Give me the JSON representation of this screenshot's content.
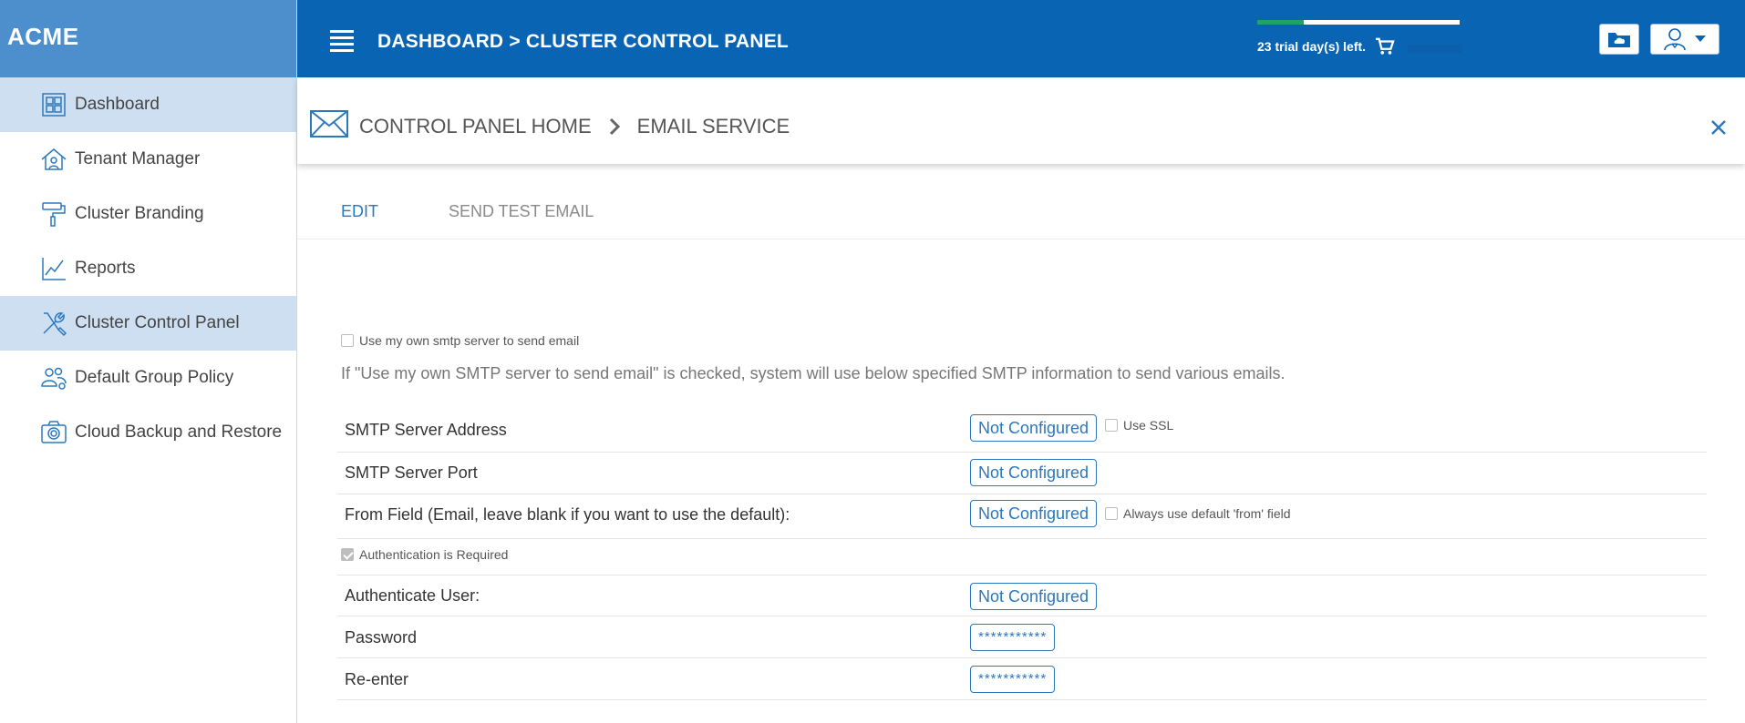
{
  "brand": "ACME",
  "sidebar": {
    "items": [
      {
        "label": "Dashboard",
        "icon": "dashboard-grid-icon",
        "active": true
      },
      {
        "label": "Tenant Manager",
        "icon": "tenant-house-icon",
        "active": false
      },
      {
        "label": "Cluster Branding",
        "icon": "paint-roller-icon",
        "active": false
      },
      {
        "label": "Reports",
        "icon": "line-chart-icon",
        "active": false
      },
      {
        "label": "Cluster Control Panel",
        "icon": "wrench-screwdriver-icon",
        "active": true
      },
      {
        "label": "Default Group Policy",
        "icon": "users-gear-icon",
        "active": false
      },
      {
        "label": "Cloud Backup and Restore",
        "icon": "camera-icon",
        "active": false
      }
    ]
  },
  "topbar": {
    "title": "DASHBOARD > CLUSTER CONTROL PANEL",
    "trial_text": "23 trial day(s) left.",
    "trial_progress": 0.23
  },
  "breadcrumb": {
    "home": "CONTROL PANEL HOME",
    "current": "EMAIL SERVICE"
  },
  "tabs": {
    "edit": "EDIT",
    "send_test": "SEND TEST EMAIL"
  },
  "form": {
    "use_own_smtp_label": "Use my own smtp server to send email",
    "use_own_smtp_checked": false,
    "help_text": "If \"Use my own SMTP server to send email\" is checked, system will use below specified SMTP information to send various emails.",
    "server_address_label": "SMTP Server Address",
    "server_address_value": "Not Configured",
    "use_ssl_label": "Use SSL",
    "server_port_label": "SMTP Server Port",
    "server_port_value": "Not Configured",
    "from_field_label": "From Field (Email, leave blank if you want to use the default):",
    "from_field_value": "Not Configured",
    "always_default_label": "Always use default 'from' field",
    "auth_required_label": "Authentication is Required",
    "auth_required_checked": true,
    "auth_user_label": "Authenticate User:",
    "auth_user_value": "Not Configured",
    "password_label": "Password",
    "password_value": "***********",
    "reenter_label": "Re-enter",
    "reenter_value": "***********"
  },
  "colors": {
    "topbar": "#0a64b4",
    "brand": "#4d8fcd",
    "active_nav": "#cddff0",
    "accent": "#2c78bd",
    "trial_fill": "#1fa36d"
  }
}
